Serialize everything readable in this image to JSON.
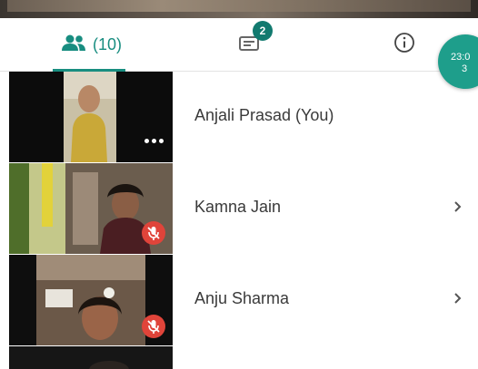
{
  "tabs": {
    "participants_count": "(10)",
    "chat_badge": "2"
  },
  "timer": {
    "line1": "23:0",
    "line2": "3"
  },
  "participants": [
    {
      "name": "Anjali Prasad (You)",
      "muted": false
    },
    {
      "name": "Kamna Jain",
      "muted": true
    },
    {
      "name": "Anju Sharma",
      "muted": true
    }
  ],
  "colors": {
    "accent": "#188d80",
    "mic_off": "#e0443a"
  },
  "icons": [
    "people-icon",
    "chat-icon",
    "info-icon",
    "chevron-right-icon",
    "mic-off-icon",
    "more-icon"
  ]
}
